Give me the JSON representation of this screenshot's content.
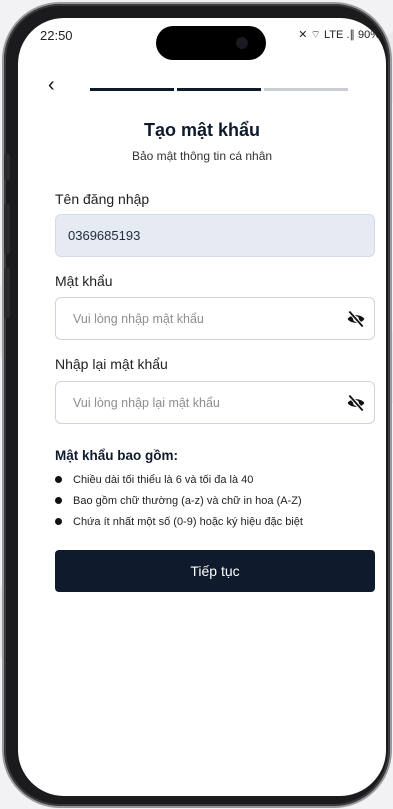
{
  "status_bar": {
    "time": "22:50",
    "indicators": "✕ ⌔ LTE .∥ 90%"
  },
  "nav": {
    "back_icon": "‹"
  },
  "progress": {
    "steps": 3,
    "completed": 2
  },
  "header": {
    "title": "Tạo mật khẩu",
    "subtitle": "Bảo mật thông tin cá nhân"
  },
  "form": {
    "username_label": "Tên đăng nhập",
    "username_value": "0369685193",
    "password_label": "Mật khẩu",
    "password_placeholder": "Vui lòng nhập mật khẩu",
    "confirm_label": "Nhập lại mật khẩu",
    "confirm_placeholder": "Vui lòng nhập lại mật khẩu"
  },
  "rules": {
    "title": "Mật khẩu bao gồm:",
    "items": [
      "Chiều dài tối thiểu là 6 và tối đa là 40",
      "Bao gồm chữ thường (a-z) và chữ in hoa (A-Z)",
      "Chứa ít nhất một số (0-9) hoặc ký hiệu đặc biệt"
    ]
  },
  "actions": {
    "continue_label": "Tiếp tục"
  },
  "colors": {
    "primary": "#0f1b2d",
    "progress_inactive": "#c9ccd2"
  },
  "icons": {
    "password_toggle": "eye-off-icon"
  }
}
